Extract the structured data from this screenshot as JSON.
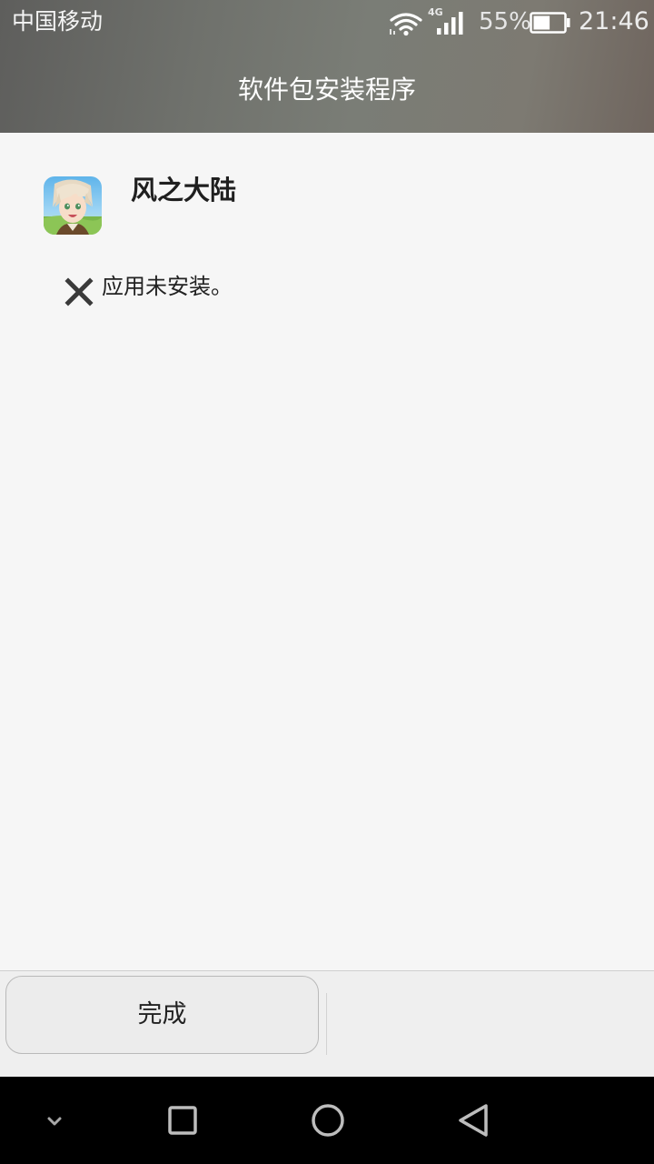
{
  "status_bar": {
    "carrier": "中国移动",
    "network_type": "4G",
    "battery_percent": "55%",
    "battery_level": 0.55,
    "time": "21:46",
    "icons": [
      "wifi-icon",
      "signal-icon",
      "battery-icon"
    ]
  },
  "header": {
    "title": "软件包安装程序"
  },
  "app": {
    "name": "风之大陆",
    "icon": "app-icon"
  },
  "install_status": {
    "icon": "close-icon",
    "message": "应用未安装。"
  },
  "actions": {
    "done_label": "完成"
  },
  "nav_bar": {
    "buttons": [
      "chevron-down-icon",
      "recent-apps-icon",
      "home-icon",
      "back-icon"
    ]
  },
  "colors": {
    "background": "#f6f6f6",
    "action_bar": "#efefef",
    "nav_bar": "#000000",
    "text_primary": "#1f1f1f"
  }
}
